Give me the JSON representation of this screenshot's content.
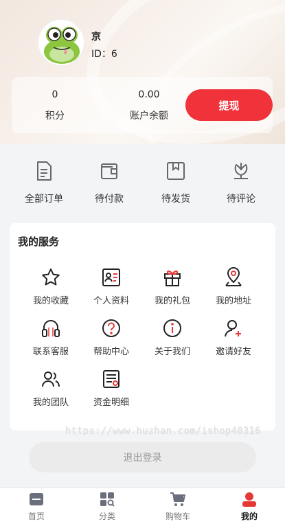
{
  "profile": {
    "name": "京",
    "id_text": "ID：6"
  },
  "stats": {
    "points_value": "0",
    "points_label": "积分",
    "balance_value": "0.00",
    "balance_label": "账户余额",
    "withdraw_label": "提现"
  },
  "orders": [
    {
      "label": "全部订单",
      "icon": "document-list-icon"
    },
    {
      "label": "待付款",
      "icon": "wallet-icon"
    },
    {
      "label": "待发货",
      "icon": "box-icon"
    },
    {
      "label": "待评论",
      "icon": "flower-icon"
    }
  ],
  "services": {
    "title": "我的服务",
    "items": [
      {
        "label": "我的收藏",
        "icon": "star-icon"
      },
      {
        "label": "个人资料",
        "icon": "id-card-icon"
      },
      {
        "label": "我的礼包",
        "icon": "gift-icon"
      },
      {
        "label": "我的地址",
        "icon": "location-pin-icon"
      },
      {
        "label": "联系客服",
        "icon": "headset-icon"
      },
      {
        "label": "帮助中心",
        "icon": "help-icon"
      },
      {
        "label": "关于我们",
        "icon": "info-icon"
      },
      {
        "label": "邀请好友",
        "icon": "add-user-icon"
      },
      {
        "label": "我的团队",
        "icon": "team-icon"
      },
      {
        "label": "资金明细",
        "icon": "funds-detail-icon"
      }
    ]
  },
  "watermark": "https://www.huzhan.com/ishop40316",
  "logout_label": "退出登录",
  "tabbar": {
    "items": [
      {
        "label": "首页",
        "icon": "home-icon"
      },
      {
        "label": "分类",
        "icon": "category-icon"
      },
      {
        "label": "购物车",
        "icon": "cart-icon"
      },
      {
        "label": "我的",
        "icon": "profile-icon"
      }
    ],
    "active_index": 3
  },
  "colors": {
    "accent": "#f0323a",
    "icon": "#333333",
    "tab_inactive": "#6b6f7b"
  }
}
